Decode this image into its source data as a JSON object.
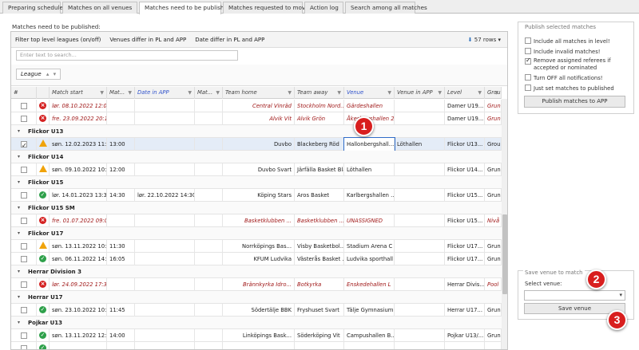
{
  "tabs": [
    {
      "label": "Preparing schedule"
    },
    {
      "label": "Matches on all venues"
    },
    {
      "label": "Matches need to be published"
    },
    {
      "label": "Matches requested to move"
    },
    {
      "label": "Action log"
    },
    {
      "label": "Search among all matches"
    }
  ],
  "page_title": "Matches need to be published:",
  "toolbar": {
    "filter_top": "Filter top level leagues (on/off)",
    "venues_differ": "Venues differ in PL and APP",
    "date_differ": "Date differ in PL and APP",
    "rows_count": "57 rows"
  },
  "search": {
    "placeholder": "Enter text to search..."
  },
  "group_chip": "League",
  "columns": [
    "#",
    "",
    "Match start",
    "Mat...",
    "Date in APP",
    "Mat...",
    "Team home",
    "Team away",
    "Venue",
    "Venue in APP",
    "Level",
    "Grou"
  ],
  "rows": [
    {
      "type": "match",
      "red": true,
      "check": false,
      "status": "x",
      "start": "lør. 08.10.2022 12:00",
      "mtime": "",
      "date_app": "",
      "mat": "",
      "home": "Central Vinräd",
      "away": "Stockholm Nord...",
      "venue": "Gärdeshallen",
      "venue_app": "",
      "level": "Damer U19...",
      "group": "Grun"
    },
    {
      "type": "match",
      "red": true,
      "check": false,
      "status": "x",
      "start": "fre. 23.09.2022 20:13",
      "mtime": "",
      "date_app": "",
      "mat": "",
      "home": "Alvik Vit",
      "away": "Alvik Grön",
      "venue": "Åkeshovshallen 2",
      "venue_app": "",
      "level": "Damer U19...",
      "group": "Grun"
    },
    {
      "type": "group",
      "title": "Flickor U13"
    },
    {
      "type": "match",
      "red": false,
      "sel": true,
      "check": true,
      "status": "warn",
      "start": "søn. 12.02.2023 11:30",
      "mtime": "13:00",
      "date_app": "",
      "mat": "",
      "home": "Duvbo",
      "away": "Blackeberg Röd",
      "venue": "Hallonbergshall...",
      "venue_app": "Löthallen",
      "level": "Flickor U13...",
      "group": "Grou"
    },
    {
      "type": "group",
      "title": "Flickor U14"
    },
    {
      "type": "match",
      "red": false,
      "check": false,
      "status": "warn",
      "start": "søn. 09.10.2022 10:30",
      "mtime": "12:00",
      "date_app": "",
      "mat": "",
      "home": "Duvbo Svart",
      "away": "Järfälla Basket Blå",
      "venue": "Löthallen",
      "venue_app": "",
      "level": "Flickor U14...",
      "group": "Grun"
    },
    {
      "type": "group",
      "title": "Flickor U15"
    },
    {
      "type": "match",
      "red": false,
      "check": false,
      "status": "ok",
      "start": "lør. 14.01.2023 13:30",
      "mtime": "14:30",
      "date_app": "lør. 22.10.2022 14:30",
      "mat": "",
      "home": "Köping Stars",
      "away": "Aros Basket",
      "venue": "Karlbergshallen ...",
      "venue_app": "",
      "level": "Flickor U15...",
      "group": "Grun"
    },
    {
      "type": "group",
      "title": "Flickor U15 SM"
    },
    {
      "type": "match",
      "red": true,
      "check": false,
      "status": "x",
      "start": "fre. 01.07.2022 09:00",
      "mtime": "",
      "date_app": "",
      "mat": "",
      "home": "Basketklubben ...",
      "away": "Basketklubben ...",
      "venue": "UNASSIGNED",
      "venue_app": "",
      "level": "Flickor U15...",
      "group": "Nivå"
    },
    {
      "type": "group",
      "title": "Flickor U17"
    },
    {
      "type": "match",
      "red": false,
      "check": false,
      "status": "warn",
      "start": "søn. 13.11.2022 10:00",
      "mtime": "11:30",
      "date_app": "",
      "mat": "",
      "home": "Norrköpings Bas...",
      "away": "Visby Basketbol...",
      "venue": "Stadium Arena C",
      "venue_app": "",
      "level": "Flickor U17...",
      "group": "Grun"
    },
    {
      "type": "match",
      "red": false,
      "check": false,
      "status": "ok",
      "start": "søn. 06.11.2022 14:35",
      "mtime": "16:05",
      "date_app": "",
      "mat": "",
      "home": "KFUM Ludvika",
      "away": "Västerås Basket ...",
      "venue": "Ludvika sporthall",
      "venue_app": "",
      "level": "Flickor U17...",
      "group": "Grun"
    },
    {
      "type": "group",
      "title": "Herrar Division 3"
    },
    {
      "type": "match",
      "red": true,
      "check": false,
      "status": "x",
      "start": "lør. 24.09.2022 17:30",
      "mtime": "",
      "date_app": "",
      "mat": "",
      "home": "Brännkyrka Idro...",
      "away": "Botkyrka",
      "venue": "Enskedehallen L",
      "venue_app": "",
      "level": "Herrar Divis...",
      "group": "Pool"
    },
    {
      "type": "group",
      "title": "Herrar U17"
    },
    {
      "type": "match",
      "red": false,
      "check": false,
      "status": "ok",
      "start": "søn. 23.10.2022 10:00",
      "mtime": "11:45",
      "date_app": "",
      "mat": "",
      "home": "Södertälje BBK",
      "away": "Fryshuset Svart",
      "venue": "Tälje Gymnasium",
      "venue_app": "",
      "level": "Herrar U17...",
      "group": "Grun"
    },
    {
      "type": "group",
      "title": "Pojkar U13"
    },
    {
      "type": "match",
      "red": false,
      "check": false,
      "status": "ok",
      "start": "søn. 13.11.2022 12:30",
      "mtime": "14:00",
      "date_app": "",
      "mat": "",
      "home": "Linköpings Bask...",
      "away": "Söderköping Vit",
      "venue": "Campushallen B...",
      "venue_app": "",
      "level": "Pojkar U13/...",
      "group": "Grun"
    },
    {
      "type": "match",
      "red": false,
      "check": false,
      "status": "ok",
      "start": "",
      "mtime": "",
      "date_app": "",
      "mat": "",
      "home": "",
      "away": "",
      "venue": "",
      "venue_app": "",
      "level": "",
      "group": ""
    }
  ],
  "publish_panel": {
    "legend": "Publish selected matches",
    "options": [
      {
        "label": "Include all matches in level!",
        "checked": false
      },
      {
        "label": "Include invalid matches!",
        "checked": false
      },
      {
        "label": "Remove assigned referees if accepted or nominated",
        "checked": true
      },
      {
        "label": "Turn OFF all notifications!",
        "checked": false
      },
      {
        "label": "Just set matches to published",
        "checked": false
      }
    ],
    "button": "Publish matches to APP"
  },
  "venue_panel": {
    "legend": "Save venue to match",
    "select_label": "Select venue:",
    "select_value": "",
    "button": "Save venue"
  },
  "callouts": [
    "1",
    "2",
    "3"
  ],
  "colors": {
    "badge": "#d81e1e",
    "red_text": "#a01818",
    "selected_row": "#e4ecf7",
    "link_blue": "#3355cc"
  }
}
